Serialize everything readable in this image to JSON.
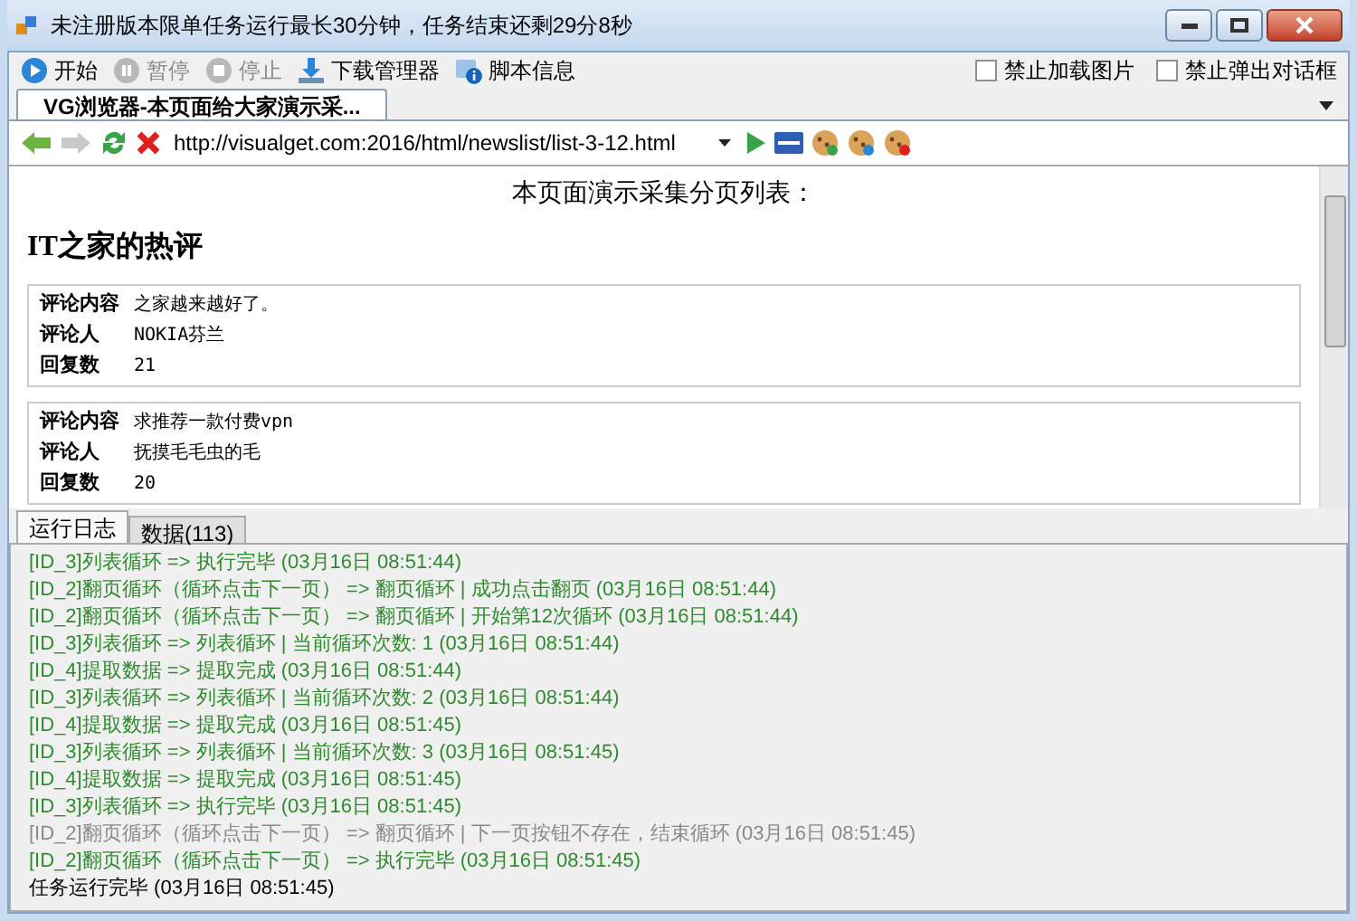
{
  "window": {
    "title": "未注册版本限单任务运行最长30分钟，任务结束还剩29分8秒"
  },
  "toolbar": {
    "buttons": [
      {
        "label": "开始",
        "disabled": false,
        "kind": "play"
      },
      {
        "label": "暂停",
        "disabled": true,
        "kind": "pause"
      },
      {
        "label": "停止",
        "disabled": true,
        "kind": "stop"
      },
      {
        "label": "下载管理器",
        "disabled": false,
        "kind": "download"
      },
      {
        "label": "脚本信息",
        "disabled": false,
        "kind": "info"
      }
    ],
    "checkboxes": [
      {
        "label": "禁止加载图片",
        "checked": false
      },
      {
        "label": "禁止弹出对话框",
        "checked": false
      }
    ]
  },
  "browser_tabs": [
    {
      "label": "VG浏览器-本页面给大家演示采...",
      "selected": true
    }
  ],
  "address_bar": {
    "url": "http://visualget.com:2016/html/newslist/list-3-12.html"
  },
  "page": {
    "caption": "本页面演示采集分页列表：",
    "heading": "IT之家的热评",
    "comments": [
      {
        "fields": [
          {
            "label": "评论内容",
            "value": "之家越来越好了。"
          },
          {
            "label": "评论人",
            "value": "NOKIA芬兰"
          },
          {
            "label": "回复数",
            "value": "21"
          }
        ]
      },
      {
        "fields": [
          {
            "label": "评论内容",
            "value": "求推荐一款付费vpn"
          },
          {
            "label": "评论人",
            "value": "抚摸毛毛虫的毛"
          },
          {
            "label": "回复数",
            "value": "20"
          }
        ]
      }
    ]
  },
  "log_tabs": [
    {
      "label": "运行日志",
      "selected": true
    },
    {
      "label": "数据(113)",
      "selected": false
    }
  ],
  "log": [
    {
      "kind": "success",
      "text": "[ID_3]列表循环 => 执行完毕 (03月16日 08:51:44)"
    },
    {
      "kind": "success",
      "text": "[ID_2]翻页循环（循环点击下一页） => 翻页循环 | 成功点击翻页 (03月16日 08:51:44)"
    },
    {
      "kind": "success",
      "text": "[ID_2]翻页循环（循环点击下一页） => 翻页循环 | 开始第12次循环 (03月16日 08:51:44)"
    },
    {
      "kind": "success",
      "text": "[ID_3]列表循环 => 列表循环 | 当前循环次数: 1 (03月16日 08:51:44)"
    },
    {
      "kind": "success",
      "text": "[ID_4]提取数据 => 提取完成 (03月16日 08:51:44)"
    },
    {
      "kind": "success",
      "text": "[ID_3]列表循环 => 列表循环 | 当前循环次数: 2 (03月16日 08:51:44)"
    },
    {
      "kind": "success",
      "text": "[ID_4]提取数据 => 提取完成 (03月16日 08:51:45)"
    },
    {
      "kind": "success",
      "text": "[ID_3]列表循环 => 列表循环 | 当前循环次数: 3 (03月16日 08:51:45)"
    },
    {
      "kind": "success",
      "text": "[ID_4]提取数据 => 提取完成 (03月16日 08:51:45)"
    },
    {
      "kind": "success",
      "text": "[ID_3]列表循环 => 执行完毕 (03月16日 08:51:45)"
    },
    {
      "kind": "info",
      "text": "[ID_2]翻页循环（循环点击下一页） => 翻页循环 | 下一页按钮不存在，结束循环 (03月16日 08:51:45)"
    },
    {
      "kind": "success",
      "text": "[ID_2]翻页循环（循环点击下一页） => 执行完毕 (03月16日 08:51:45)"
    },
    {
      "kind": "plain",
      "text": "任务运行完毕 (03月16日 08:51:45)"
    }
  ]
}
